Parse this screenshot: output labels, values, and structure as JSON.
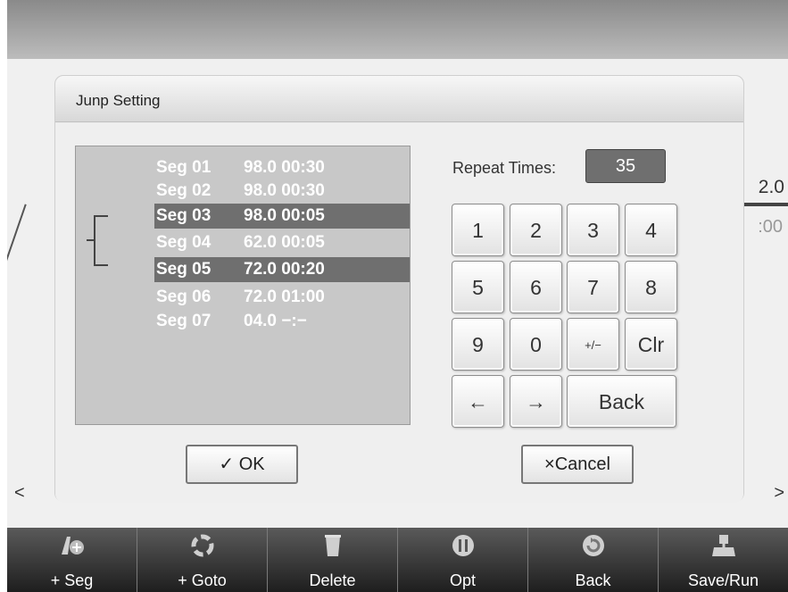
{
  "background": {
    "value": "2.0",
    "time": ":00",
    "nav_left": "<",
    "nav_right": ">"
  },
  "dialog": {
    "title": "Junp Setting",
    "segments": [
      {
        "name": "Seg 01",
        "value": "98.0 00:30",
        "selected": false
      },
      {
        "name": "Seg 02",
        "value": "98.0 00:30",
        "selected": false
      },
      {
        "name": "Seg 03",
        "value": "98.0 00:05",
        "selected": true
      },
      {
        "name": "Seg 04",
        "value": "62.0 00:05",
        "selected": false
      },
      {
        "name": "Seg 05",
        "value": "72.0 00:20",
        "selected": true
      },
      {
        "name": "Seg 06",
        "value": "72.0 01:00",
        "selected": false
      },
      {
        "name": "Seg 07",
        "value": "04.0 −:−",
        "selected": false
      }
    ],
    "repeat_label": "Repeat Times:",
    "repeat_value": "35",
    "keypad": {
      "k1": "1",
      "k2": "2",
      "k3": "3",
      "k4": "4",
      "k5": "5",
      "k6": "6",
      "k7": "7",
      "k8": "8",
      "k9": "9",
      "k0": "0",
      "plusminus": "+/−",
      "clr": "Clr",
      "left": "←",
      "right": "→",
      "back": "Back"
    },
    "ok_label": "✓ OK",
    "cancel_label": "×Cancel"
  },
  "toolbar": [
    {
      "label": "+ Seg",
      "icon": "add-segment-icon"
    },
    {
      "label": "+ Goto",
      "icon": "goto-icon"
    },
    {
      "label": "Delete",
      "icon": "trash-icon"
    },
    {
      "label": "Opt",
      "icon": "pause-icon"
    },
    {
      "label": "Back",
      "icon": "back-icon"
    },
    {
      "label": "Save/Run",
      "icon": "save-run-icon"
    }
  ]
}
